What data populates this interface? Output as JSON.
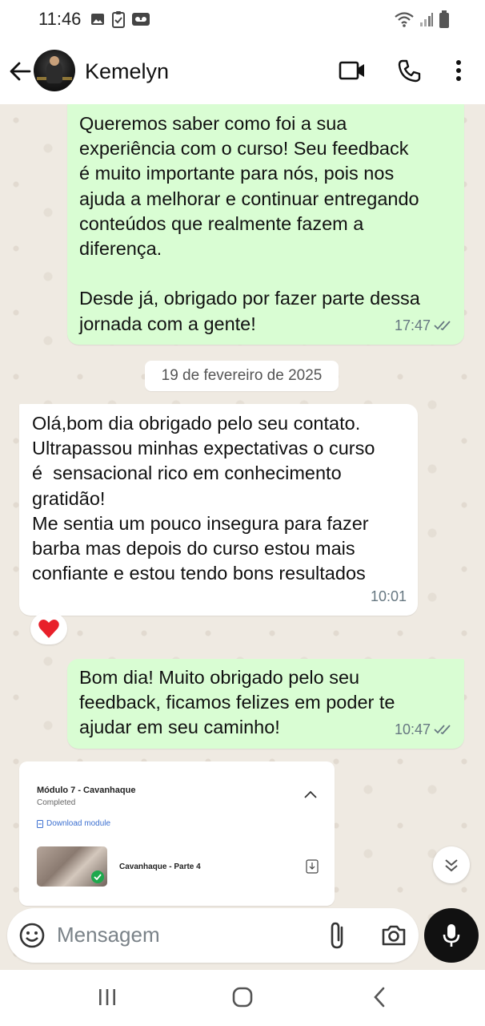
{
  "status_bar": {
    "time": "11:46",
    "left_icons": [
      "image-icon",
      "clipboard-icon",
      "voicemail-icon"
    ],
    "right_icons": [
      "wifi-icon",
      "signal-icon",
      "battery-icon"
    ]
  },
  "header": {
    "contact_name": "Kemelyn",
    "icons": [
      "back-arrow-icon",
      "video-call-icon",
      "phone-icon",
      "more-vert-icon"
    ]
  },
  "messages": [
    {
      "direction": "outgoing",
      "text": "Queremos saber como foi a sua\nexperiência com o curso! Seu feedback\né muito importante para nós, pois nos\najuda a melhorar e continuar entregando\nconteúdos que realmente fazem a\ndiferença.\n\nDesde já, obrigado por fazer parte dessa\njornada com a gente!",
      "time": "17:47",
      "status": "read"
    },
    {
      "direction": "incoming",
      "text": "Olá,bom dia obrigado pelo seu contato.\nUltrapassou minhas expectativas o curso\né  sensacional rico em conhecimento\ngratidão!\nMe sentia um pouco insegura para fazer\nbarba mas depois do curso estou mais\nconfiante e estou tendo bons resultados",
      "time": "10:01",
      "reaction": "❤️"
    },
    {
      "direction": "outgoing",
      "text": "Bom dia! Muito obrigado pelo seu\nfeedback, ficamos felizes em poder te\najudar em seu caminho!",
      "time": "10:47",
      "status": "read"
    }
  ],
  "date_separator": "19 de fevereiro de 2025",
  "module_card": {
    "title": "Módulo 7 - Cavanhaque",
    "status": "Completed",
    "download_label": "Download module",
    "lesson": "Cavanhaque - Parte 4"
  },
  "composer": {
    "placeholder": "Mensagem"
  },
  "colors": {
    "outgoing_bubble": "#d9fdd3",
    "incoming_bubble": "#ffffff",
    "chat_background": "#efeae2",
    "read_ticks": "#667781",
    "mic_button": "#111111"
  }
}
